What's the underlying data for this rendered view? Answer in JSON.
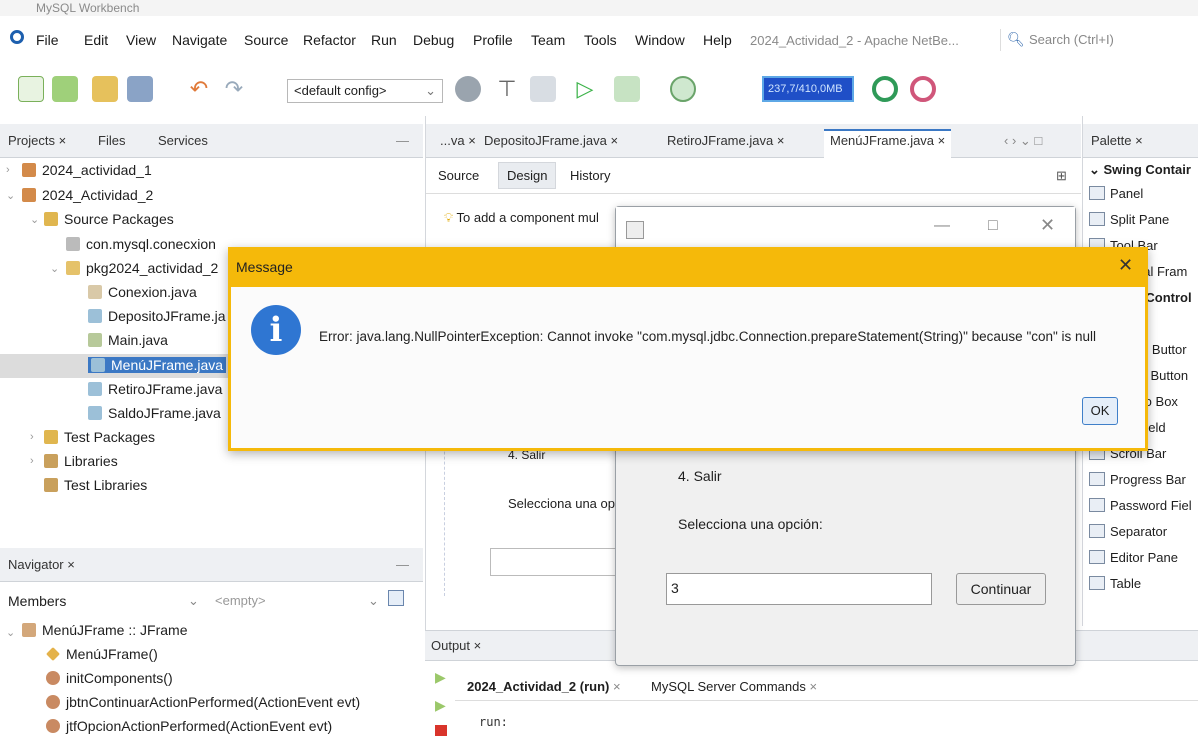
{
  "window": {
    "workbench_title": "MySQL Workbench",
    "netbeans_title": "2024_Actividad_2 - Apache NetBe...",
    "search_placeholder": "Search (Ctrl+I)"
  },
  "menu": [
    "File",
    "Edit",
    "View",
    "Navigate",
    "Source",
    "Refactor",
    "Run",
    "Debug",
    "Profile",
    "Team",
    "Tools",
    "Window",
    "Help"
  ],
  "toolbar": {
    "config": "<default config>",
    "memory": "237,7/410,0MB"
  },
  "projects_panel": {
    "tabs": [
      "Projects",
      "Files",
      "Services"
    ],
    "tree": [
      "2024_actividad_1",
      "2024_Actividad_2",
      "Source Packages",
      "con.mysql.conecxion",
      "pkg2024_actividad_2",
      "Conexion.java",
      "DepositoJFrame.ja",
      "Main.java",
      "MenúJFrame.java",
      "RetiroJFrame.java",
      "SaldoJFrame.java",
      "Test Packages",
      "Libraries",
      "Test Libraries"
    ]
  },
  "navigator": {
    "title": "Navigator",
    "members_label": "Members",
    "filter_placeholder": "<empty>",
    "items": [
      "MenúJFrame :: JFrame",
      "MenúJFrame()",
      "initComponents()",
      "jbtnContinuarActionPerformed(ActionEvent evt)",
      "jtfOpcionActionPerformed(ActionEvent evt)"
    ]
  },
  "editor": {
    "tabs": [
      "...va",
      "DepositoJFrame.java",
      "RetiroJFrame.java",
      "MenúJFrame.java"
    ],
    "subtabs": [
      "Source",
      "Design",
      "History"
    ],
    "hint": "To add a component mul",
    "design_salir": "4. Salir",
    "design_selecciona": "Selecciona una op"
  },
  "palette": {
    "title": "Palette",
    "items": [
      "Swing Contair",
      "Panel",
      "Split Pane",
      "Tool Bar",
      "Internal Fram",
      "Swing Control",
      "Toggle Buttor",
      "Check Button",
      "Combo Box",
      "Text Field",
      "Scroll Bar",
      "Progress Bar",
      "Password Fiel",
      "Separator",
      "Editor Pane",
      "Table"
    ]
  },
  "menu_frame": {
    "salir": "4. Salir",
    "prompt": "Selecciona una opción:",
    "input_value": "3",
    "continuar": "Continuar"
  },
  "dialog": {
    "title": "Message",
    "message": "Error: java.lang.NullPointerException: Cannot invoke \"com.mysql.jdbc.Connection.prepareStatement(String)\" because \"con\" is null",
    "ok": "OK"
  },
  "output": {
    "title": "Output",
    "tabs": [
      "2024_Actividad_2 (run)",
      "MySQL Server Commands"
    ],
    "text": "run:"
  },
  "colors": {
    "dialog_accent": "#f5b90a",
    "selection": "#3b78c4",
    "info_icon": "#2f76d2"
  }
}
